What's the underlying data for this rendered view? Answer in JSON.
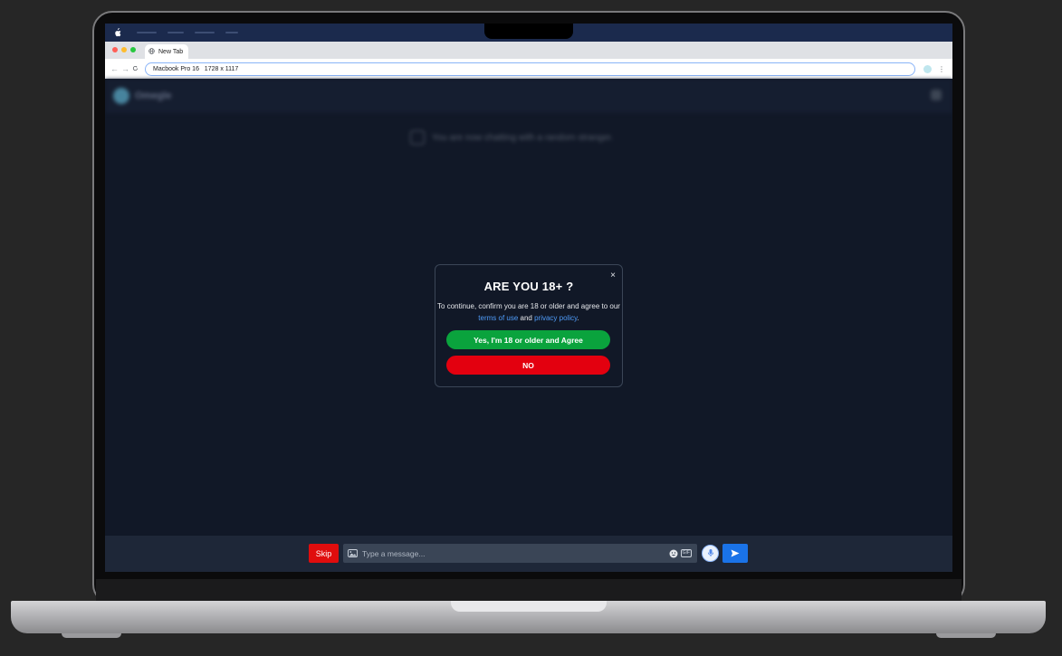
{
  "browser": {
    "tab_title": "New Tab",
    "address": "Macbook Pro 16   1728 x 1117"
  },
  "app": {
    "brand": "Omegle",
    "status_text": "You are now chatting with a random stranger."
  },
  "modal": {
    "title": "ARE YOU 18+ ?",
    "text_before": "To continue, confirm you are 18 or older and agree to our ",
    "terms_link": "terms of use",
    "text_and": " and ",
    "privacy_link": "privacy policy",
    "text_end": ".",
    "close_label": "×",
    "yes_label": "Yes, I'm 18 or older and Agree",
    "no_label": "NO"
  },
  "chat_bar": {
    "skip_label": "Skip",
    "message_placeholder": "Type a message...",
    "gif_label": "GIF"
  },
  "colors": {
    "yes": "#0aa33d",
    "no": "#e3000f",
    "skip": "#e00d0d",
    "send": "#1a73e8",
    "link": "#4f9cf9"
  }
}
